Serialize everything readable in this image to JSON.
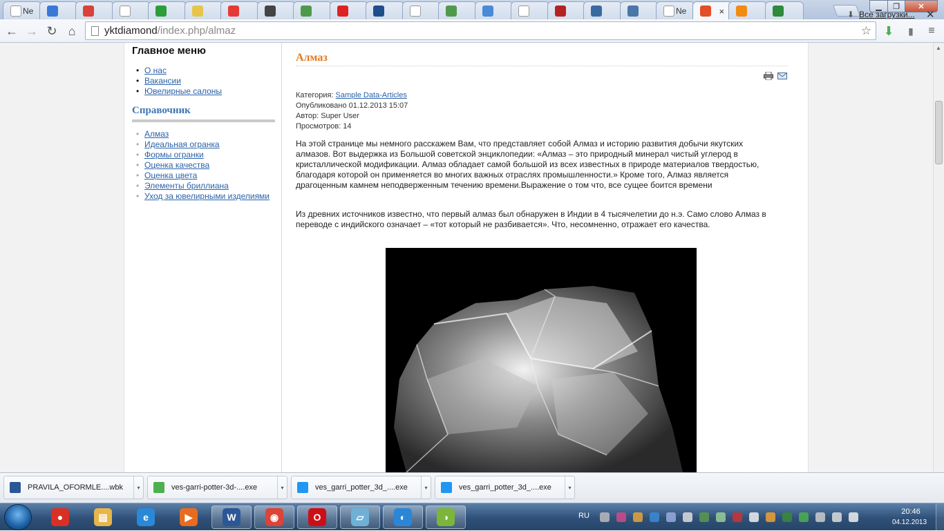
{
  "browser": {
    "tabs": [
      {
        "label": "Ne",
        "icon": "page-icon",
        "color": "#ffffff"
      },
      {
        "label": "",
        "icon": "blue-circle-icon",
        "color": "#3a78d8"
      },
      {
        "label": "",
        "icon": "target-icon",
        "color": "#d9413a"
      },
      {
        "label": "",
        "icon": "page-icon",
        "color": "#ffffff"
      },
      {
        "label": "",
        "icon": "windows-icon",
        "color": "#2c9d3a"
      },
      {
        "label": "",
        "icon": "lightbulb-icon",
        "color": "#e6c54a"
      },
      {
        "label": "",
        "icon": "yandex-icon",
        "color": "#e53935"
      },
      {
        "label": "",
        "icon": "graduation-cap-icon",
        "color": "#444444"
      },
      {
        "label": "",
        "icon": "check-book-icon",
        "color": "#4f9a4a"
      },
      {
        "label": "",
        "icon": "red-x-icon",
        "color": "#d22"
      },
      {
        "label": "",
        "icon": "r-icon",
        "color": "#1e4e8c"
      },
      {
        "label": "",
        "icon": "page-icon",
        "color": "#ffffff"
      },
      {
        "label": "",
        "icon": "check-book-icon",
        "color": "#4f9a4a"
      },
      {
        "label": "",
        "icon": "v-circle-icon",
        "color": "#4a8ad6"
      },
      {
        "label": "",
        "icon": "page-icon",
        "color": "#ffffff"
      },
      {
        "label": "",
        "icon": "grid-icon",
        "color": "#b52222"
      },
      {
        "label": "",
        "icon": "play-icon",
        "color": "#3a6aa0"
      },
      {
        "label": "",
        "icon": "vk-icon",
        "color": "#4a76a8"
      },
      {
        "label": "Ne",
        "icon": "page-icon",
        "color": "#ffffff"
      },
      {
        "label": "",
        "icon": "chrome-icon",
        "color": "#e44d26",
        "active": true
      },
      {
        "label": "",
        "icon": "joomla-icon",
        "color": "#f38b12"
      },
      {
        "label": "",
        "icon": "puzzle-icon",
        "color": "#2e8b3a"
      }
    ],
    "url_host": "yktdiamond",
    "url_path": "/index.php/almaz"
  },
  "sidebar": {
    "main_menu_title": "Главное меню",
    "main_menu": [
      "О нас",
      "Вакансии",
      "Ювелирные салоны"
    ],
    "ref_title": "Справочник",
    "ref_menu": [
      "Алмаз",
      "Идеальная огранка",
      "Формы огранки",
      "Оценка качества",
      "Оценка цвета",
      "Элементы бриллиана",
      "Уход за ювелирными изделиями"
    ]
  },
  "article": {
    "title": "Алмаз",
    "category_label": "Категория: ",
    "category": "Sample Data-Articles",
    "published": "Опубликовано 01.12.2013 15:07",
    "author": "Автор: Super User",
    "views": "Просмотров: 14",
    "para1_lines": [
      "На этой странице мы немного расскажем Вам, что представляет собой Алмаз и историю развития добычи якутских",
      "алмазов. Вот выдержка из Большой советской энциклопедии: «Алмаз – это природный минерал чистый углерод в",
      "кристаллической модификации. Алмаз обладает самой большой из всех известных в природе материалов твердостью,",
      "благодаря которой он применяется во многих важных отраслях промышленности.» Кроме того,  Алмаз является",
      "драгоценным камнем неподверженным течению времени.Выражение о том что, все сущее боится времени"
    ],
    "para2_lines": [
      "Из древних источников известно, что первый алмаз был обнаружен в Индии в 4 тысячелетии до н.э. Само слово Алмаз в",
      "переводе с индийского означает – «тот который не разбивается». Что, несомненно, отражает его качества."
    ],
    "title_color": "#e0781f",
    "link_color": "#2a62a8"
  },
  "downloads": {
    "items": [
      {
        "name": "PRAVILA_OFORMLE....wbk",
        "icon": "word-doc-icon",
        "color": "#2b5797"
      },
      {
        "name": "ves-garri-potter-3d-....exe",
        "icon": "download-arrow-icon",
        "color": "#4caf50"
      },
      {
        "name": "ves_garri_potter_3d_....exe",
        "icon": "z-installer-icon",
        "color": "#2196f3"
      },
      {
        "name": "ves_garri_potter_3d_....exe",
        "icon": "z-installer-icon",
        "color": "#2196f3"
      }
    ],
    "all_label": "Все загрузки...",
    "close": "✕"
  },
  "taskbar": {
    "apps": [
      {
        "name": "browser-red-app-icon",
        "color": "#d93025",
        "glyph": "●"
      },
      {
        "name": "explorer-folder-icon",
        "color": "#e8b54a",
        "glyph": "▤"
      },
      {
        "name": "internet-explorer-icon",
        "color": "#2a88d8",
        "glyph": "e"
      },
      {
        "name": "media-player-icon",
        "color": "#e86c1f",
        "glyph": "▶"
      },
      {
        "name": "word-icon",
        "color": "#2b5797",
        "glyph": "W",
        "open": true
      },
      {
        "name": "chrome-icon",
        "color": "#db4437",
        "glyph": "◉",
        "open": true
      },
      {
        "name": "opera-icon",
        "color": "#cc0f16",
        "glyph": "O",
        "open": true
      },
      {
        "name": "notepad-icon",
        "color": "#6fb0d6",
        "glyph": "▱",
        "open": true
      },
      {
        "name": "blue-app-icon",
        "color": "#2c86d6",
        "glyph": "◐",
        "open": true
      },
      {
        "name": "green-app-icon",
        "color": "#7bb63a",
        "glyph": "◑",
        "open": true
      }
    ],
    "lang": "RU",
    "time": "20:46",
    "date": "04.12.2013"
  }
}
